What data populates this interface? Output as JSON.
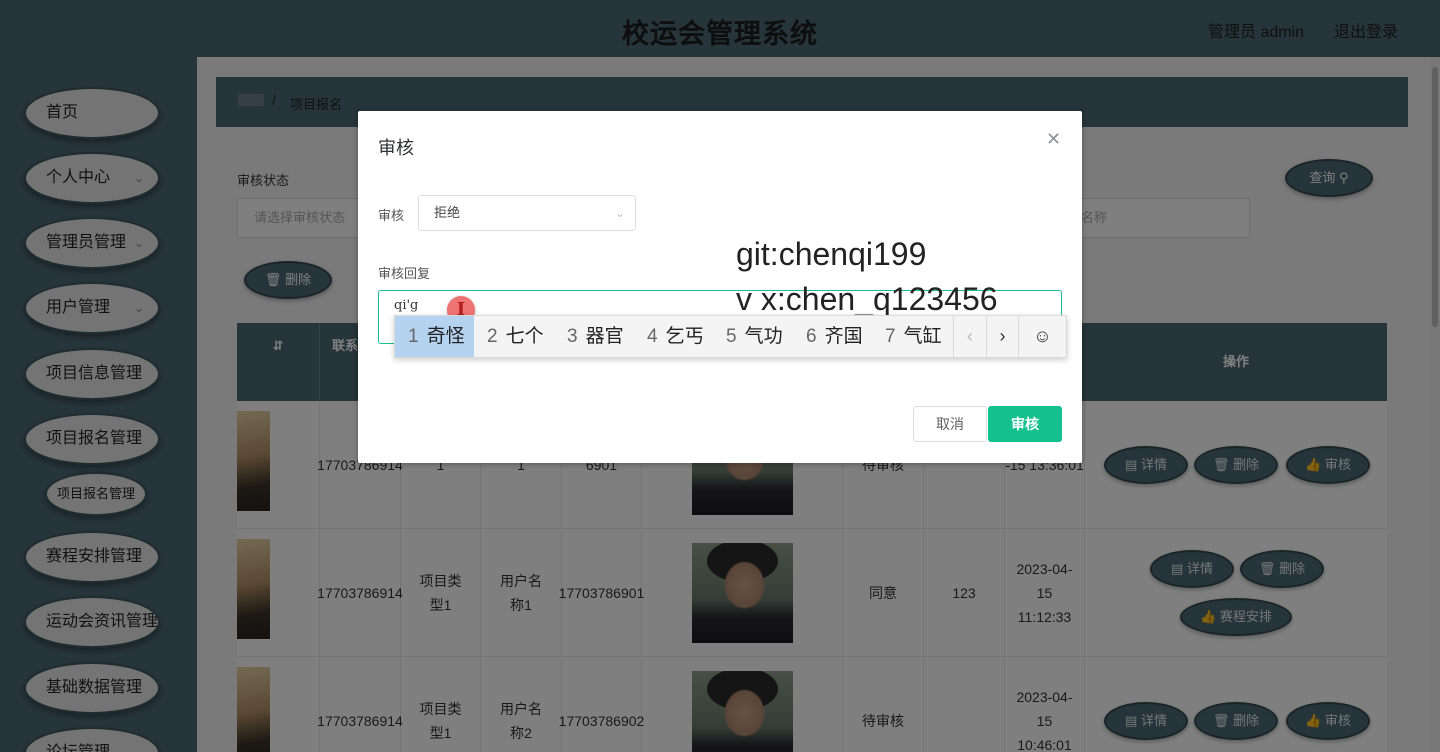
{
  "header": {
    "title": "校运会管理系统",
    "user": "管理员 admin",
    "logout": "退出登录"
  },
  "sidebar": {
    "items": [
      {
        "label": "首页"
      },
      {
        "label": "个人中心"
      },
      {
        "label": "管理员管理"
      },
      {
        "label": "用户管理"
      },
      {
        "label": "项目信息管理"
      },
      {
        "label": "项目报名管理"
      },
      {
        "label": "项目报名管理"
      },
      {
        "label": "赛程安排管理"
      },
      {
        "label": "运动会资讯管理"
      },
      {
        "label": "基础数据管理"
      },
      {
        "label": "论坛管理"
      }
    ]
  },
  "breadcrumb": {
    "separator": "/",
    "current": "项目报名"
  },
  "filter": {
    "status_label": "审核状态",
    "status_placeholder": "请选择审核状态",
    "name_placeholder": "名称",
    "search_label": "查询",
    "delete_label": "删除"
  },
  "table": {
    "headers": [
      "联系",
      "操作"
    ],
    "rows": [
      {
        "phone": "17703786914",
        "type": "1",
        "user": "1",
        "user_phone": "6901",
        "status": "待审核",
        "reply": "",
        "time": "-15 13:36:01",
        "actions": [
          "详情",
          "删除",
          "审核"
        ]
      },
      {
        "phone": "17703786914",
        "type": "项目类型1",
        "user": "用户名称1",
        "user_phone": "17703786901",
        "status": "同意",
        "reply": "123",
        "time": "2023-04-15 11:12:33",
        "actions": [
          "详情",
          "删除",
          "赛程安排"
        ]
      },
      {
        "phone": "17703786914",
        "type": "项目类型1",
        "user": "用户名称2",
        "user_phone": "17703786902",
        "status": "待审核",
        "reply": "",
        "time": "2023-04-15 10:46:01",
        "actions": [
          "详情",
          "删除",
          "审核"
        ]
      }
    ]
  },
  "dialog": {
    "title": "审核",
    "field_label": "审核",
    "field_value": "拒绝",
    "reply_label": "审核回复",
    "reply_value": "qi'g",
    "cancel": "取消",
    "confirm": "审核"
  },
  "watermark": {
    "line1": "git:chenqi199",
    "line2": "v x:chen_q123456"
  },
  "ime": {
    "candidates": [
      {
        "num": "1",
        "text": "奇怪"
      },
      {
        "num": "2",
        "text": "七个"
      },
      {
        "num": "3",
        "text": "器官"
      },
      {
        "num": "4",
        "text": "乞丐"
      },
      {
        "num": "5",
        "text": "气功"
      },
      {
        "num": "6",
        "text": "齐国"
      },
      {
        "num": "7",
        "text": "气缸"
      }
    ]
  },
  "colors": {
    "teal_dark": "#4d6b75",
    "accent_green": "#13c08e"
  }
}
